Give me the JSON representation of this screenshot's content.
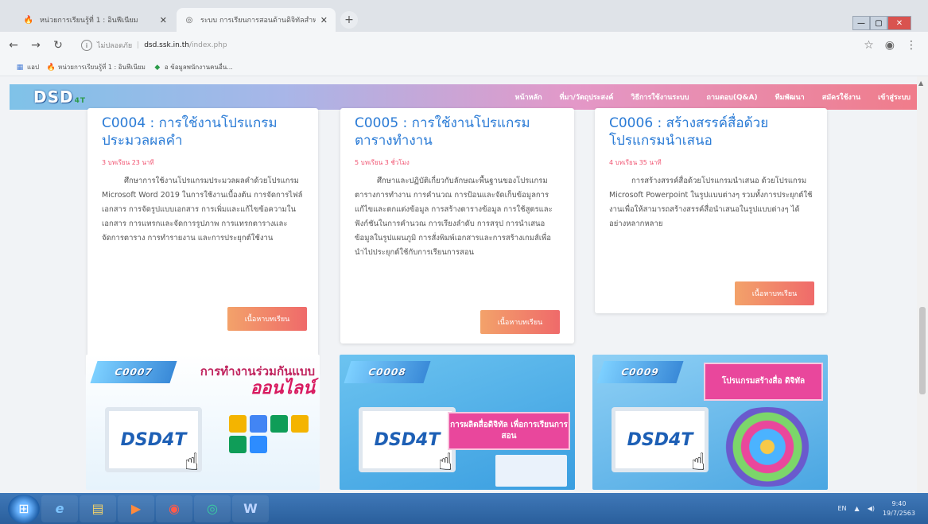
{
  "browser": {
    "tabs": [
      {
        "title": "หน่วยการเรียนรู้ที่ 1 : อินฟีเนียม",
        "active": false
      },
      {
        "title": "ระบบ การเรียนการสอนด้านดิจิทัลสำหรับ",
        "active": true
      }
    ],
    "new_tab": "+",
    "url": {
      "security": "ไม่ปลอดภัย",
      "domain": "dsd.ssk.in.th",
      "path": "/index.php"
    },
    "bookmarks": [
      {
        "label": "แอป",
        "icon": "apps-grid-icon"
      },
      {
        "label": "หน่วยการเรียนรู้ที่ 1 : อินฟีเนียม",
        "icon": "bookmark-favicon-icon"
      },
      {
        "label": "อ ข้อมูลพนักงานคนอื่น...",
        "icon": "bookmark-favicon-icon"
      }
    ]
  },
  "site": {
    "logo": "DSD",
    "logo_sub": "4T",
    "menu": [
      "หน้าหลัก",
      "ที่มา/วัตถุประสงค์",
      "วิธีการใช้งานระบบ",
      "ถามตอบ(Q&A)",
      "ทีมพัฒนา",
      "สมัครใช้งาน",
      "เข้าสู่ระบบ"
    ]
  },
  "courses": [
    {
      "code_title": "C0004 : การใช้งานโปรแกรมประมวลผลคำ",
      "meta": "3 บทเรียน 23 นาที",
      "desc": "ศึกษาการใช้งานโปรแกรมประมวลผลคำด้วยโปรแกรม Microsoft Word 2019 ในการใช้งานเบื้องต้น การจัดการไฟล์เอกสาร การจัดรูปแบบเอกสาร การเพิ่มและแก้ไขข้อความในเอกสาร การแทรกและจัดการรูปภาพ การแทรกตารางและจัดการตาราง การทำรายงาน และการประยุกต์ใช้งาน",
      "button": "เนื้อหาบทเรียน"
    },
    {
      "code_title": "C0005 : การใช้งานโปรแกรมตารางทำงาน",
      "meta": "5 บทเรียน 3 ชั่วโมง",
      "desc": "ศึกษาและปฏิบัติเกี่ยวกับลักษณะพื้นฐานของโปรแกรมตารางการทำงาน การคำนวณ การป้อนและจัดเก็บข้อมูลการแก้ไขและตกแต่งข้อมูล การสร้างตารางข้อมูล การใช้สูตรและฟังก์ชันในการคำนวณ การเรียงลำดับ การสรุป การนำเสนอข้อมูลในรูปแผนภูมิ การสั่งพิมพ์เอกสารและการสร้างเกมส์เพื่อนำไปประยุกต์ใช้กับการเรียนการสอน",
      "button": "เนื้อหาบทเรียน"
    },
    {
      "code_title": "C0006 : สร้างสรรค์สื่อด้วยโปรแกรมนำเสนอ",
      "meta": "4 บทเรียน 35 นาที",
      "desc": "การสร้างสรรค์สื่อด้วยโปรแกรมนำเสนอ ด้วยโปรแกรม Microsoft Powerpoint ในรูปแบบต่างๆ รวมทั้งการประยุกต์ใช้งานเพื่อให้สามารถสร้างสรรค์สื่อนำเสนอในรูปแบบต่างๆ ได้อย่างหลากหลาย",
      "button": "เนื้อหาบทเรียน"
    }
  ],
  "banners": [
    {
      "code": "C0007",
      "headline": "การทำงานร่วมกันแบบ",
      "headline_big": "ออนไลน์",
      "brand": "DSD4T"
    },
    {
      "code": "C0008",
      "pink_text": "การผลิตสื่อดิจิทัล เพื่อการเรียนการสอน",
      "brand": "DSD4T"
    },
    {
      "code": "C0009",
      "pink_text": "โปรแกรมสร้างสื่อ ดิจิทัล",
      "brand": "DSD4T"
    }
  ],
  "taskbar": {
    "apps": [
      "internet-explorer-icon",
      "file-explorer-icon",
      "media-player-icon",
      "chrome-icon",
      "edge-icon",
      "word-icon"
    ],
    "lang": "EN",
    "time": "9:40",
    "date": "19/7/2563"
  },
  "colors": {
    "title_blue": "#2a7bd6",
    "meta_pink": "#f0506e",
    "button_orange": "#ef8a6a"
  }
}
